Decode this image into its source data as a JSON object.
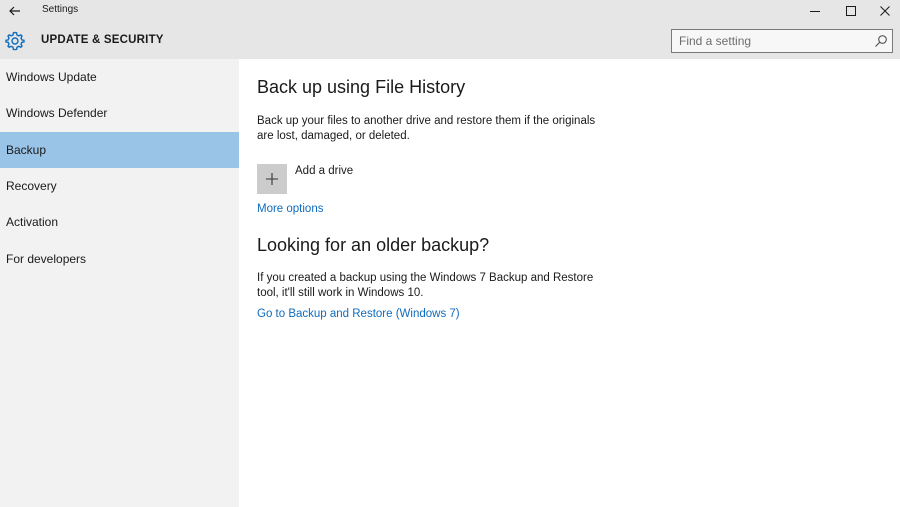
{
  "window": {
    "title": "Settings"
  },
  "header": {
    "title": "UPDATE & SECURITY",
    "icon": "gear-icon",
    "search_placeholder": "Find a setting"
  },
  "sidebar": {
    "items": [
      {
        "label": "Windows Update",
        "active": false
      },
      {
        "label": "Windows Defender",
        "active": false
      },
      {
        "label": "Backup",
        "active": true
      },
      {
        "label": "Recovery",
        "active": false
      },
      {
        "label": "Activation",
        "active": false
      },
      {
        "label": "For developers",
        "active": false
      }
    ]
  },
  "main": {
    "file_history": {
      "heading": "Back up using File History",
      "description": "Back up your files to another drive and restore them if the originals are lost, damaged, or deleted.",
      "add_drive_label": "Add a drive",
      "more_options_link": "More options"
    },
    "older_backup": {
      "heading": "Looking for an older backup?",
      "description": "If you created a backup using the Windows 7 Backup and Restore tool, it'll still work in Windows 10.",
      "link": "Go to Backup and Restore (Windows 7)"
    }
  },
  "colors": {
    "accent": "#0f6cbd",
    "selected_nav": "#99c4e8",
    "chrome": "#e6e6e6",
    "sidebar": "#f2f2f2"
  }
}
